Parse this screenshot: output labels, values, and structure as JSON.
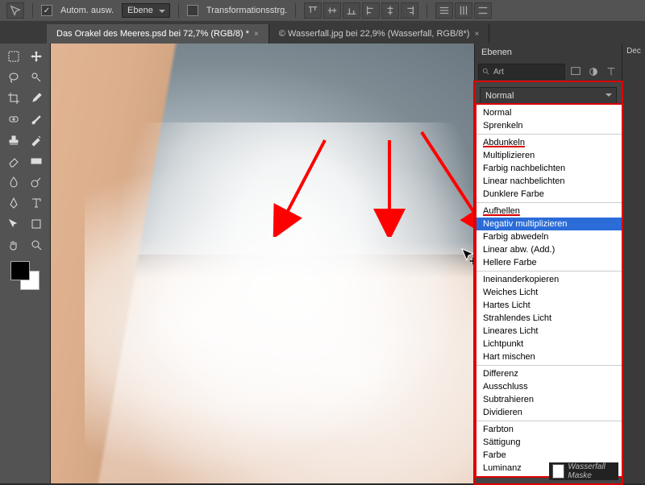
{
  "topbar": {
    "auto_select_label": "Autom. ausw.",
    "auto_select_checked": true,
    "layer_dropdown": "Ebene",
    "transform_controls_label": "Transformationsstrg.",
    "transform_controls_checked": false
  },
  "document_tabs": [
    {
      "label": "Das Orakel des Meeres.psd bei 72,7% (RGB/8) *",
      "active": true
    },
    {
      "label": "© Wasserfall.jpg bei 22,9% (Wasserfall, RGB/8*)",
      "active": false
    }
  ],
  "right_panel": {
    "tab_label": "Ebenen",
    "search_placeholder": "Art",
    "truncated_label": "Dec",
    "blend_mode_selected": "Normal",
    "mask_label": "Wasserfall Maske",
    "blend_groups": [
      {
        "items": [
          "Normal",
          "Sprenkeln"
        ]
      },
      {
        "header": "Abdunkeln",
        "header_red": true,
        "items": [
          "Multiplizieren",
          "Farbig nachbelichten",
          "Linear nachbelichten",
          "Dunklere Farbe"
        ]
      },
      {
        "header": "Aufhellen",
        "header_red": true,
        "items": [
          {
            "label": "Negativ multiplizieren",
            "highlight": true
          },
          "Farbig abwedeln",
          "Linear abw. (Add.)",
          "Hellere Farbe"
        ]
      },
      {
        "items": [
          "Ineinanderkopieren",
          "Weiches Licht",
          "Hartes Licht",
          "Strahlendes Licht",
          "Lineares Licht",
          "Lichtpunkt",
          "Hart mischen"
        ]
      },
      {
        "items": [
          "Differenz",
          "Ausschluss",
          "Subtrahieren",
          "Dividieren"
        ]
      },
      {
        "items": [
          "Farbton",
          "Sättigung",
          "Farbe",
          "Luminanz"
        ]
      }
    ]
  },
  "tools": [
    "move",
    "marquee",
    "lasso",
    "wand",
    "crop",
    "eyedrop",
    "heal",
    "brush",
    "stamp",
    "history",
    "eraser",
    "gradient",
    "blur",
    "dodge",
    "pen",
    "type",
    "path",
    "shape",
    "hand",
    "zoom"
  ],
  "annotation_arrows": 3
}
